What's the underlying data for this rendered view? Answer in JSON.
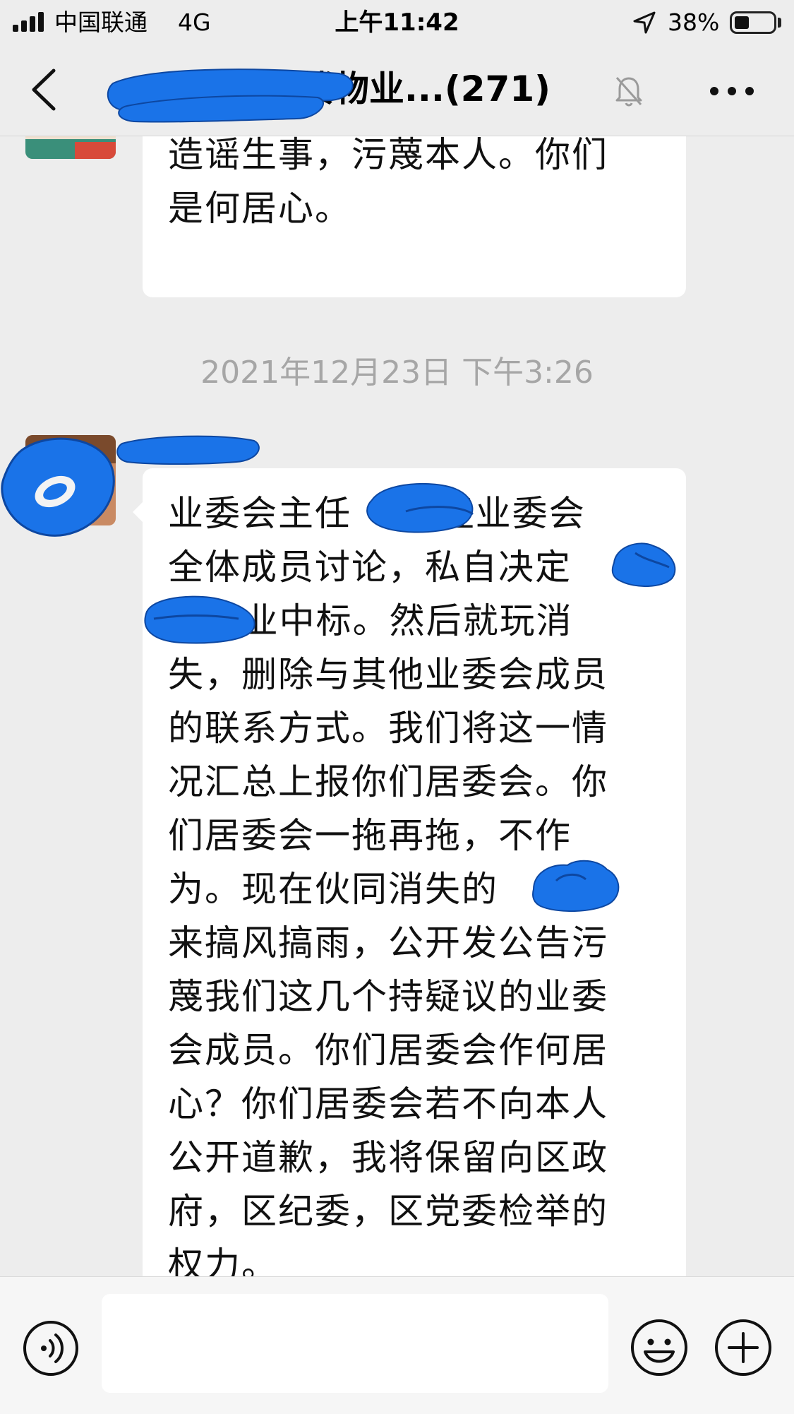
{
  "status_bar": {
    "carrier": "中国联通",
    "network": "4G",
    "time": "上午11:42",
    "battery_percent": "38%",
    "battery_level": 0.38
  },
  "nav": {
    "title": "楼物业...(271)",
    "icons": {
      "back": "chevron-left-icon",
      "mute": "bell-slash-icon",
      "more": "ellipsis-icon"
    }
  },
  "chat": {
    "messages": [
      {
        "text": "你们居委会不作为，最后来\n造谣生事，污蔑本人。你们\n是何居心。"
      },
      {
        "timestamp": "2021年12月23日 下午3:26"
      },
      {
        "text": "业委会主任    未经业委会\n全体成员讨论，私自决定\n   物业中标。然后就玩消\n失，删除与其他业委会成员\n的联系方式。我们将这一情\n况汇总上报你们居委会。你\n们居委会一拖再拖，不作\n为。现在伙同消失的    回\n来搞风搞雨，公开发公告污\n蔑我们这几个持疑议的业委\n会成员。你们居委会作何居\n心？你们居委会若不向本人\n公开道歉，我将保留向区政\n府，区纪委，区党委检举的\n权力。"
      }
    ]
  },
  "input_bar": {
    "placeholder": "",
    "icons": {
      "voice": "voice-icon",
      "emoji": "emoji-icon",
      "plus": "plus-icon"
    }
  },
  "colors": {
    "background": "#ededed",
    "bubble": "#ffffff",
    "redaction": "#1a73e8",
    "timestamp": "#a6a6a6"
  }
}
